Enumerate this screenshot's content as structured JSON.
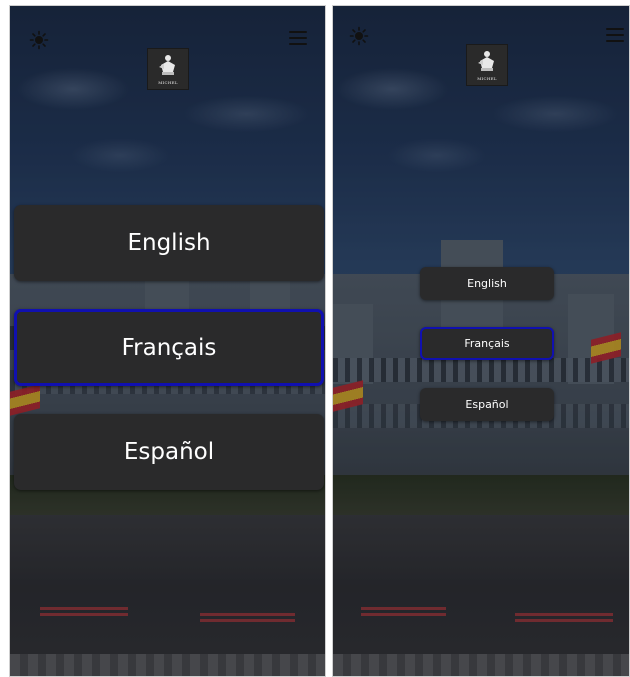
{
  "logo": {
    "text": "MICHEL"
  },
  "language_selector": {
    "options": [
      "English",
      "Français",
      "Español"
    ],
    "selected": "Français"
  },
  "colors": {
    "button_bg": "#2a2a2b",
    "button_text": "#ffffff",
    "selected_border": "#1010b0"
  },
  "icons": [
    "sun-icon",
    "menu-icon"
  ]
}
